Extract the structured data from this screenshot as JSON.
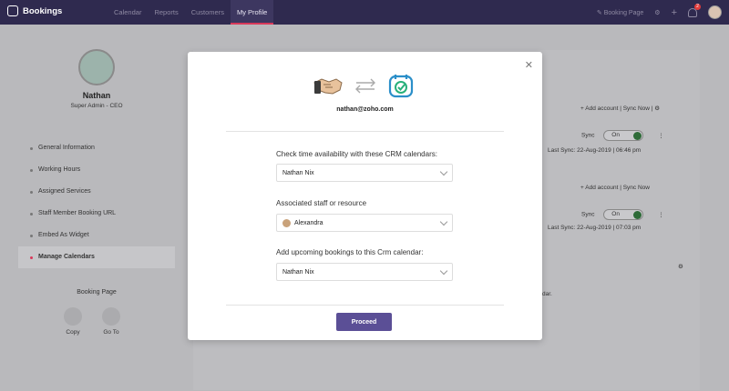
{
  "app": {
    "name": "Bookings"
  },
  "nav": {
    "tabs": [
      "Calendar",
      "Reports",
      "Customers",
      "My Profile"
    ],
    "active": "My Profile"
  },
  "topbar": {
    "booking_page": "Booking Page",
    "notification_count": "2"
  },
  "profile": {
    "name": "Nathan",
    "role": "Super Admin - CEO"
  },
  "sidebar": {
    "items": [
      {
        "label": "General Information"
      },
      {
        "label": "Working Hours"
      },
      {
        "label": "Assigned Services"
      },
      {
        "label": "Staff Member Booking URL"
      },
      {
        "label": "Embed As Widget"
      },
      {
        "label": "Manage Calendars"
      }
    ],
    "active": "Manage Calendars",
    "booking_page": {
      "title": "Booking Page",
      "copy": "Copy",
      "goto": "Go To"
    }
  },
  "background": {
    "add_account": "+ Add account",
    "sync_now": "Sync Now",
    "sync_label": "Sync",
    "sync_state": "On",
    "last_sync_label": "Last Sync:",
    "last_sync_1": "22-Aug-2019 | 06:46 pm",
    "last_sync_2": "22-Aug-2019 | 07:03 pm",
    "footer_fragment": "dar."
  },
  "modal": {
    "email": "nathan@zoho.com",
    "field1": {
      "label": "Check time availability with these CRM calendars:",
      "value": "Nathan Nix"
    },
    "field2": {
      "label": "Associated staff or resource",
      "value": "Alexandra"
    },
    "field3": {
      "label": "Add upcoming bookings to this Crm calendar:",
      "value": "Nathan Nix"
    },
    "proceed_label": "Proceed"
  },
  "colors": {
    "nav_bg": "#2f2a4f",
    "accent": "#5b4f96",
    "active_marker": "#d8385a",
    "sync_on": "#2e6b38"
  }
}
